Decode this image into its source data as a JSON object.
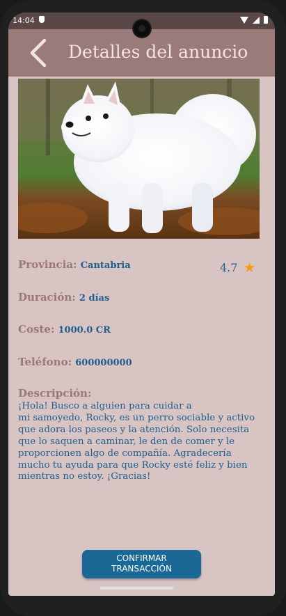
{
  "status": {
    "time": "14:04"
  },
  "appbar": {
    "title": "Detalles del anuncio"
  },
  "details": {
    "province_label": "Provincia:",
    "province_value": "Cantabria",
    "rating": "4.7",
    "duration_label": "Duración:",
    "duration_value": "2 días",
    "cost_label": "Coste:",
    "cost_value": "1000.0 CR",
    "phone_label": "Teléfono:",
    "phone_value": "600000000",
    "description_label": "Descripción:",
    "description_text": "¡Hola! Busco a alguien para cuidar a\nmi samoyedo, Rocky, es un perro sociable y activo que adora los paseos y la atención. Solo necesita que lo saquen a caminar, le den de comer y le proporcionen algo de compañía. Agradecería mucho tu ayuda para que Rocky esté feliz y bien mientras no estoy. ¡Gracias!"
  },
  "actions": {
    "confirm_line1": "CONFIRMAR",
    "confirm_line2": "TRANSACCIÓN"
  },
  "colors": {
    "appbar": "#9a7b79",
    "background": "#d9c4c4",
    "accent": "#1e5f8f",
    "button": "#1a6896",
    "star": "#f29d16"
  },
  "icons": {
    "back": "chevron-left-icon",
    "star": "star-icon"
  }
}
